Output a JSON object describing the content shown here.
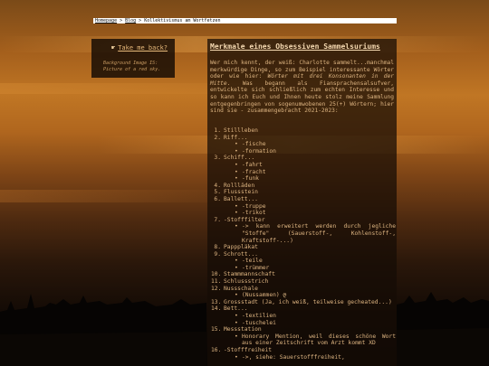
{
  "breadcrumb": {
    "home": "Homepage",
    "sep1": " > ",
    "blog": "Blog",
    "sep2": " > ",
    "current": "Kollektivismus am Wortfetzen"
  },
  "sidebar": {
    "back_label": "Take me back?",
    "credit": "Background Image IS: Picture of a red sky."
  },
  "main": {
    "title": "Merkmale eines Obsessiven Sammelsuriums",
    "intro_a": "Wer mich kennt, der weiß: Charlotte sammelt...manchmal merkwürdige Dinge, so zum Beispiel interessante Wörter oder wie hier: ",
    "intro_em": "Wörter mit drei Konsonanten in der Mitte",
    "intro_b": ". Was begann als Fiansprachensalsufver, entwickelte sich schließlich zum echten Interesse und so kann ich Euch und Ihnen heute stolz meine Sammlung entgegenbringen von sogenumwobenen 25(+) Wörtern; hier sind sie - zusammengebracht 2021-2023:"
  },
  "items": [
    {
      "n": "1.",
      "word": "Stillleben",
      "subs": []
    },
    {
      "n": "2.",
      "word": "Riff...",
      "subs": [
        "-fische",
        "-formation"
      ]
    },
    {
      "n": "3.",
      "word": "Schiff...",
      "subs": [
        "-fahrt",
        "-fracht",
        "-funk"
      ]
    },
    {
      "n": "4.",
      "word": "Rollläden",
      "subs": []
    },
    {
      "n": "5.",
      "word": "Flussstein",
      "subs": []
    },
    {
      "n": "6.",
      "word": "Ballett...",
      "subs": [
        "-truppe",
        "-trikot"
      ]
    },
    {
      "n": "7.",
      "word": "-Stofffilter",
      "subs": [
        "-> kann erweitert werden durch jegliche \"Stoffe\" (Sauerstoff-, Kohlenstoff-, Kraftstoff-...)"
      ]
    },
    {
      "n": "8.",
      "word": "Papppläkat",
      "subs": []
    },
    {
      "n": "9.",
      "word": "Schrott...",
      "subs": [
        "-teile",
        "-trümmer"
      ]
    },
    {
      "n": "10.",
      "word": "Stammmannschaft",
      "subs": []
    },
    {
      "n": "11.",
      "word": "Schlussstrich",
      "subs": []
    },
    {
      "n": "12.",
      "word": "Nussschale",
      "subs": [
        "(Nussammen)"
      ]
    },
    {
      "n": "13.",
      "word": "Grossstadt (Ja, ich weiß, teilweise gecheated...)",
      "subs": []
    },
    {
      "n": "14.",
      "word": "Bett...",
      "subs": [
        "-textilien",
        "-tuschelei"
      ]
    },
    {
      "n": "15.",
      "word": "Messstation",
      "subs": [
        "Honorary Mention, weil dieses schöne Wort aus einer Zeitschrift vom Arzt kommt XD"
      ]
    },
    {
      "n": "16.",
      "word": "-Stofffreiheit",
      "subs": [
        "->, siehe: Sauerstofffreiheit,"
      ]
    }
  ],
  "swirl_glyph": "ღ",
  "colors": {
    "text": "#ddb481",
    "title": "#f4d8b0",
    "panel": "#1a0e06",
    "sky": "#c07624"
  },
  "icons": {
    "back": "pointing-hand-icon",
    "ornament": "swirl-icon"
  }
}
